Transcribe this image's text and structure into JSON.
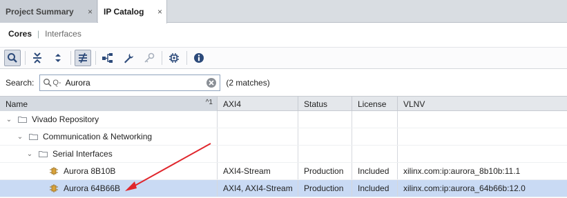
{
  "tabs": [
    {
      "label": "Project Summary",
      "close": "×"
    },
    {
      "label": "IP Catalog",
      "close": "×"
    }
  ],
  "subnav": {
    "cores": "Cores",
    "separator": "|",
    "interfaces": "Interfaces"
  },
  "toolbar": {
    "icons": [
      "search-icon",
      "collapse-all-icon",
      "expand-all-icon",
      "filter-icon",
      "hierarchy-icon",
      "wrench-icon",
      "key-icon",
      "chip-icon",
      "info-icon"
    ]
  },
  "search": {
    "label": "Search:",
    "prefix": "Q-",
    "value": "Aurora",
    "matches": "(2 matches)"
  },
  "table": {
    "headers": {
      "name": "Name",
      "sort": "^1",
      "axi": "AXI4",
      "status": "Status",
      "license": "License",
      "vlnv": "VLNV"
    },
    "rows": [
      {
        "name": "Vivado Repository",
        "axi": "",
        "status": "",
        "license": "",
        "vlnv": ""
      },
      {
        "name": "Communication & Networking",
        "axi": "",
        "status": "",
        "license": "",
        "vlnv": ""
      },
      {
        "name": "Serial Interfaces",
        "axi": "",
        "status": "",
        "license": "",
        "vlnv": ""
      },
      {
        "name": "Aurora 8B10B",
        "axi": "AXI4-Stream",
        "status": "Production",
        "license": "Included",
        "vlnv": "xilinx.com:ip:aurora_8b10b:11.1"
      },
      {
        "name": "Aurora 64B66B",
        "axi": "AXI4, AXI4-Stream",
        "status": "Production",
        "license": "Included",
        "vlnv": "xilinx.com:ip:aurora_64b66b:12.0"
      }
    ]
  },
  "colors": {
    "selected_row": "#c9daf4",
    "arrow": "#e0262c",
    "ip_icon": "#d8a23a"
  }
}
